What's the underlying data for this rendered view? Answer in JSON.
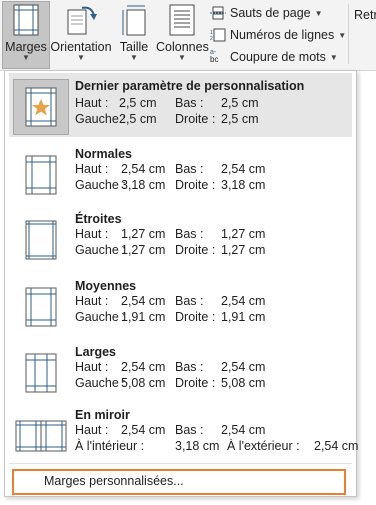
{
  "ribbon": {
    "margins": "Marges",
    "orientation": "Orientation",
    "size": "Taille",
    "columns": "Colonnes",
    "breaks": "Sauts de page",
    "line_numbers": "Numéros de lignes",
    "hyphenation": "Coupure de mots",
    "hyphen_icon_text": "bc",
    "retrait": "Retr"
  },
  "presets": [
    {
      "name": "Dernier paramètre de personnalisation",
      "haut_label": "Haut :",
      "haut": "2,5 cm",
      "bas_label": "Bas :",
      "bas": "2,5 cm",
      "left_label": "Gauche :",
      "left": "2,5 cm",
      "right_label": "Droite :",
      "right": "2,5 cm"
    },
    {
      "name": "Normales",
      "haut_label": "Haut :",
      "haut": "2,54 cm",
      "bas_label": "Bas :",
      "bas": "2,54 cm",
      "left_label": "Gauche :",
      "left": "3,18 cm",
      "right_label": "Droite :",
      "right": "3,18 cm"
    },
    {
      "name": "Étroites",
      "haut_label": "Haut :",
      "haut": "1,27 cm",
      "bas_label": "Bas :",
      "bas": "1,27 cm",
      "left_label": "Gauche :",
      "left": "1,27 cm",
      "right_label": "Droite :",
      "right": "1,27 cm"
    },
    {
      "name": "Moyennes",
      "haut_label": "Haut :",
      "haut": "2,54 cm",
      "bas_label": "Bas :",
      "bas": "2,54 cm",
      "left_label": "Gauche :",
      "left": "1,91 cm",
      "right_label": "Droite :",
      "right": "1,91 cm"
    },
    {
      "name": "Larges",
      "haut_label": "Haut :",
      "haut": "2,54 cm",
      "bas_label": "Bas :",
      "bas": "2,54 cm",
      "left_label": "Gauche :",
      "left": "5,08 cm",
      "right_label": "Droite :",
      "right": "5,08 cm"
    },
    {
      "name": "En miroir",
      "haut_label": "Haut :",
      "haut": "2,54 cm",
      "bas_label": "Bas :",
      "bas": "2,54 cm",
      "left_label": "À l'intérieur :",
      "left": "3,18 cm",
      "right_label": "À l'extérieur :",
      "right": "2,54 cm"
    }
  ],
  "custom_margins": "Marges personnalisées...",
  "colors": {
    "highlight_border": "#ed7d31",
    "star": "#e8a34a",
    "icon_blue": "#2e5f8a"
  }
}
